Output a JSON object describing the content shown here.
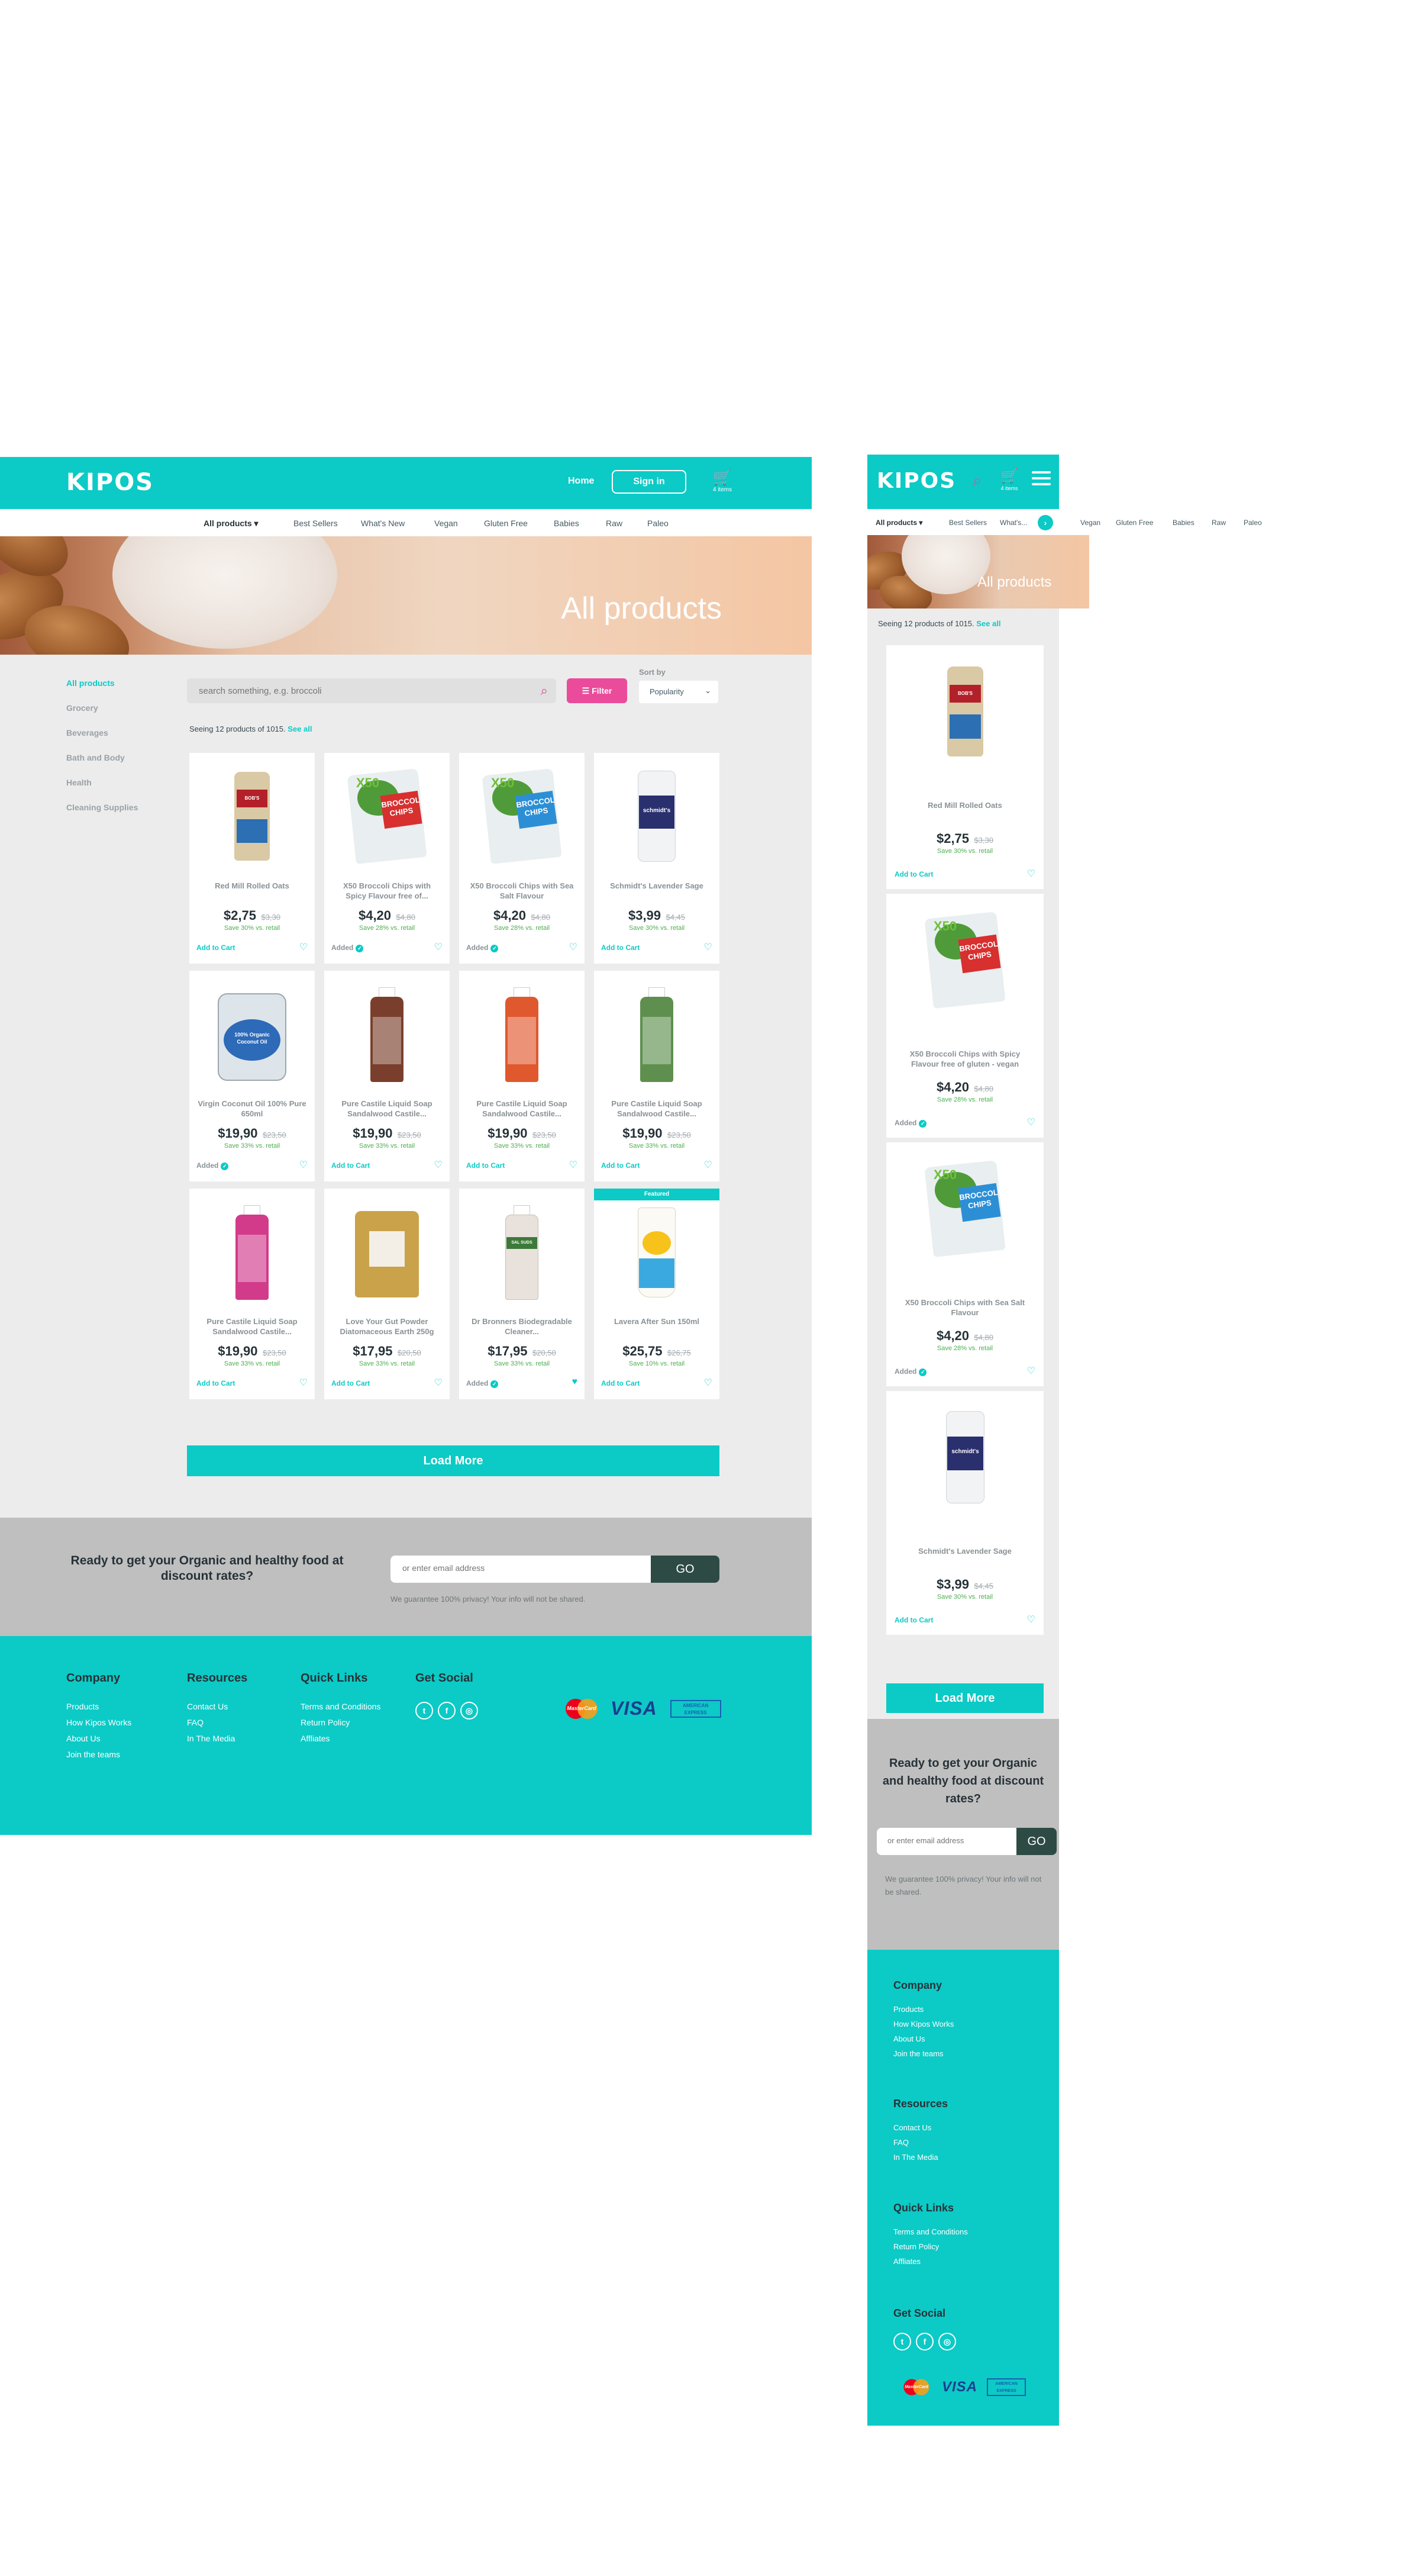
{
  "brand": {
    "logo": "KIPOS"
  },
  "header": {
    "home": "Home",
    "sign_in": "Sign in",
    "cart_count": "4 items"
  },
  "nav": {
    "categories": [
      "All products ▾",
      "Best Sellers",
      "What's New",
      "Vegan",
      "Gluten Free",
      "Babies",
      "Raw",
      "Paleo"
    ],
    "mobile_categories": [
      "All products ▾",
      "Best Sellers",
      "What's...",
      "Vegan",
      "Gluten Free",
      "Babies",
      "Raw",
      "Paleo"
    ]
  },
  "hero": {
    "title": "All products"
  },
  "sidebar": {
    "items": [
      "All products",
      "Grocery",
      "Beverages",
      "Bath and Body",
      "Health",
      "Cleaning Supplies"
    ]
  },
  "search": {
    "placeholder": "search something, e.g. broccoli"
  },
  "filter": {
    "label": "Filter"
  },
  "sort": {
    "label": "Sort by",
    "value": "Popularity"
  },
  "results": {
    "text": "Seeing 12 products of 1015.",
    "see_all": "See all"
  },
  "products": [
    {
      "name": "Red Mill Rolled Oats",
      "price": "$2,75",
      "old": "$3,30",
      "save": "Save 30% vs. retail",
      "status": "Add to Cart"
    },
    {
      "name": "X50 Broccoli Chips with Spicy Flavour free of...",
      "price": "$4,20",
      "old": "$4,80",
      "save": "Save 28% vs. retail",
      "status": "Added"
    },
    {
      "name": "X50 Broccoli Chips with Sea Salt Flavour",
      "price": "$4,20",
      "old": "$4,80",
      "save": "Save 28% vs. retail",
      "status": "Added"
    },
    {
      "name": "Schmidt's Lavender Sage",
      "price": "$3,99",
      "old": "$4,45",
      "save": "Save 30% vs. retail",
      "status": "Add to Cart"
    },
    {
      "name": "Virgin Coconut Oil 100% Pure 650ml",
      "price": "$19,90",
      "old": "$23,50",
      "save": "Save 33% vs. retail",
      "status": "Added"
    },
    {
      "name": "Pure Castile Liquid Soap Sandalwood Castile...",
      "price": "$19,90",
      "old": "$23,50",
      "save": "Save 33% vs. retail",
      "status": "Add to Cart"
    },
    {
      "name": "Pure Castile Liquid Soap Sandalwood Castile...",
      "price": "$19,90",
      "old": "$23,50",
      "save": "Save 33% vs. retail",
      "status": "Add to Cart"
    },
    {
      "name": "Pure Castile Liquid Soap Sandalwood Castile...",
      "price": "$19,90",
      "old": "$23,50",
      "save": "Save 33% vs. retail",
      "status": "Add to Cart"
    },
    {
      "name": "Pure Castile Liquid Soap Sandalwood Castile...",
      "price": "$19,90",
      "old": "$23,50",
      "save": "Save 33% vs. retail",
      "status": "Add to Cart"
    },
    {
      "name": "Love Your Gut Powder Diatomaceous Earth 250g",
      "price": "$17,95",
      "old": "$20,50",
      "save": "Save 33% vs. retail",
      "status": "Add to Cart"
    },
    {
      "name": "Dr Bronners Biodegradable Cleaner...",
      "price": "$17,95",
      "old": "$20,50",
      "save": "Save 33% vs. retail",
      "status": "Added"
    },
    {
      "name": "Lavera After Sun 150ml",
      "price": "$25,75",
      "old": "$26,75",
      "save": "Save 10% vs. retail",
      "status": "Add to Cart",
      "badge": "Featured"
    }
  ],
  "mobile_products": [
    {
      "name": "Red Mill Rolled Oats",
      "price": "$2,75",
      "old": "$3,30",
      "save": "Save 30% vs. retail",
      "status": "Add to Cart"
    },
    {
      "name": "X50 Broccoli Chips with Spicy Flavour free of gluten - vegan",
      "price": "$4,20",
      "old": "$4,80",
      "save": "Save 28% vs. retail",
      "status": "Added"
    },
    {
      "name": "X50 Broccoli Chips with Sea Salt Flavour",
      "price": "$4,20",
      "old": "$4,80",
      "save": "Save 28% vs. retail",
      "status": "Added"
    },
    {
      "name": "Schmidt's Lavender Sage",
      "price": "$3,99",
      "old": "$4,45",
      "save": "Save 30% vs. retail",
      "status": "Add to Cart"
    }
  ],
  "load_more": "Load More",
  "newsletter": {
    "question": "Ready to get your Organic and healthy food at discount rates?",
    "placeholder": "or enter email address",
    "go": "GO",
    "guarantee": "We guarantee 100% privacy! Your info will not be shared."
  },
  "footer": {
    "company": {
      "title": "Company",
      "links": [
        "Products",
        "How Kipos Works",
        "About Us",
        "Join the teams"
      ]
    },
    "resources": {
      "title": "Resources",
      "links": [
        "Contact Us",
        "FAQ",
        "In The Media"
      ]
    },
    "quick": {
      "title": "Quick Links",
      "links": [
        "Terms and Conditions",
        "Return Policy",
        "Affliates"
      ]
    },
    "social": {
      "title": "Get Social",
      "icons": [
        "twitter-icon",
        "facebook-icon",
        "instagram-icon"
      ]
    },
    "payment": {
      "mastercard": "MasterCard",
      "visa": "VISA",
      "amex": "AMERICAN EXPRESS"
    }
  },
  "colors": {
    "teal": "#0ccac6",
    "pink": "#ea4c9b",
    "dark": "#263238",
    "green": "#4caf50"
  }
}
